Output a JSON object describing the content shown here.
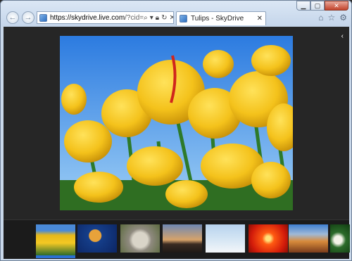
{
  "browser": {
    "url_host": "https://skydrive.live.com",
    "url_rest": "/?cid=",
    "tab_title": "Tulips - SkyDrive",
    "caption_buttons": [
      "minimize",
      "maximize",
      "close"
    ],
    "nav": {
      "back": "back-arrow-icon",
      "forward": "forward-arrow-icon"
    },
    "address_icons": [
      "search-icon",
      "dropdown-icon",
      "lock-icon",
      "refresh-icon",
      "stop-icon"
    ],
    "tools": [
      "home-icon",
      "star-icon",
      "gear-icon"
    ]
  },
  "viewer": {
    "current_photo": "Tulips",
    "colors": {
      "background": "#262626",
      "filmstrip": "#1b1b1b",
      "accent": "#2a6fd1"
    }
  },
  "filmstrip": {
    "thumbnails": [
      "tulips",
      "jellyfish",
      "koala",
      "lighthouse",
      "penguins",
      "chrysanthemum",
      "desert",
      "hydrangeas"
    ],
    "active_index": 0
  }
}
